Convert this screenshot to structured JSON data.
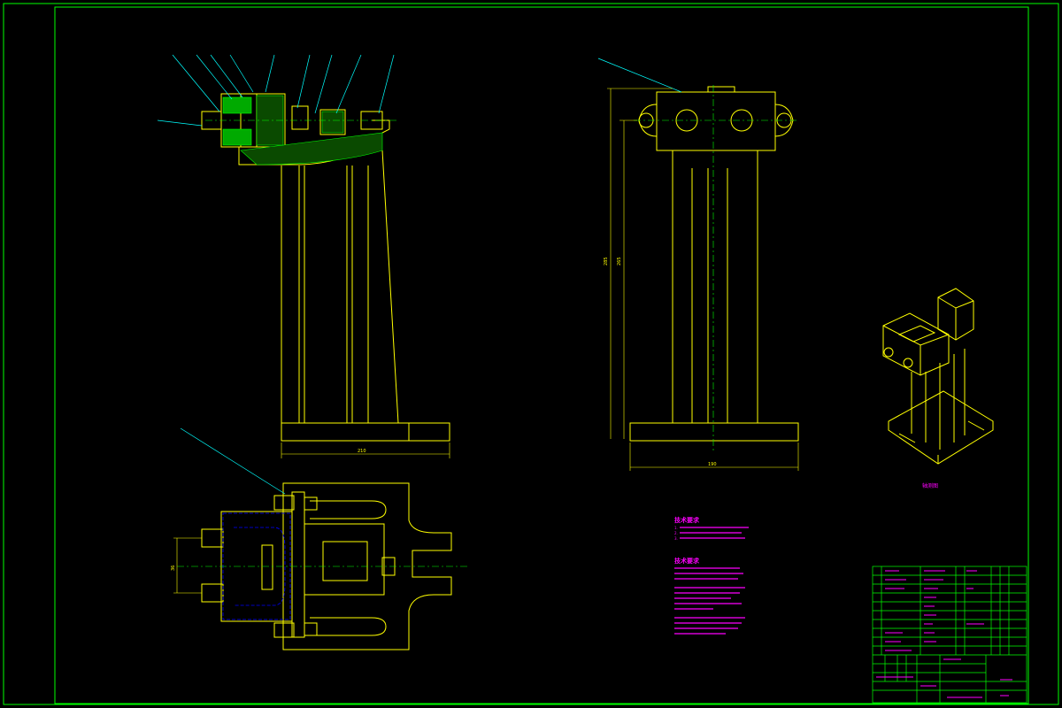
{
  "colors": {
    "background": "#000000",
    "frame": "#00ff00",
    "outline": "#ffff00",
    "centerline": "#00ff00",
    "leader": "#00ffff",
    "text": "#ff00ff",
    "hidden": "#0000ff",
    "section_hatch": "#00ff00",
    "title_block": "#00ff00"
  },
  "dimensions": {
    "front_width": "210",
    "side_height_outer": "285",
    "side_height_inner": "265",
    "side_width": "190",
    "plan_height": "36"
  },
  "labels": {
    "iso_caption": "轴测图"
  },
  "notes": {
    "title_1": "技术要求",
    "title_2": "技术要求",
    "lines_1": [
      "1.",
      "2.",
      "3."
    ]
  },
  "icons": {
    "leader": "leader-line-icon",
    "centerline": "centerline-icon"
  }
}
